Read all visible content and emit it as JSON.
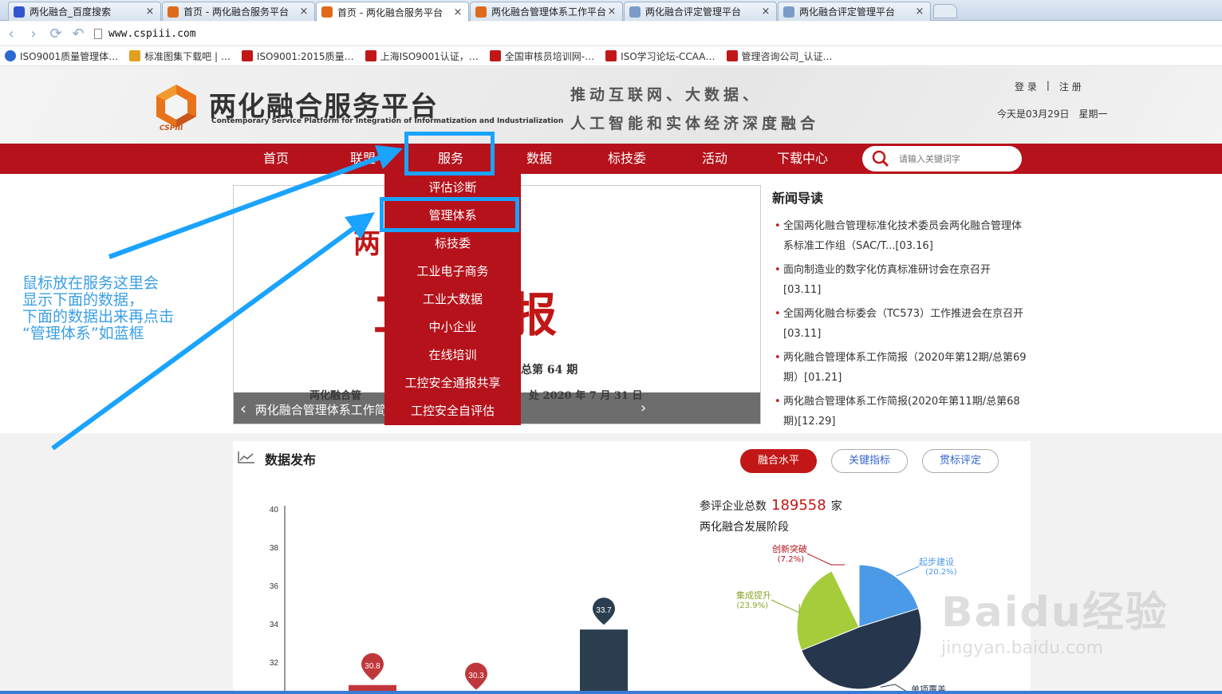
{
  "browser": {
    "tabs": [
      {
        "label": "两化融合_百度搜索",
        "color": "#3355cc"
      },
      {
        "label": "首页 - 两化融合服务平台",
        "color": "#e06a1b"
      },
      {
        "label": "首页 - 两化融合服务平台",
        "color": "#e06a1b"
      },
      {
        "label": "两化融合管理体系工作平台",
        "color": "#e06a1b"
      },
      {
        "label": "两化融合评定管理平台",
        "color": "#7a9cc6"
      },
      {
        "label": "两化融合评定管理平台",
        "color": "#7a9cc6"
      }
    ],
    "active_tab": 2,
    "url": "www.cspiii.com",
    "bookmarks": [
      {
        "label": "ISO9001质量管理体…",
        "color": "#2a6bd1"
      },
      {
        "label": "标准图集下载吧 | …",
        "color": "#e0a020"
      },
      {
        "label": "ISO9001:2015质量…",
        "color": "#c21717"
      },
      {
        "label": "上海ISO9001认证，…",
        "color": "#c21717"
      },
      {
        "label": "全国审核员培训网-…",
        "color": "#c21717"
      },
      {
        "label": "ISO学习论坛-CCAA…",
        "color": "#c21717"
      },
      {
        "label": "管理咨询公司_认证…",
        "color": "#c21717"
      }
    ]
  },
  "header": {
    "title": "两化融合服务平台",
    "subtitle": "Contemporary Service Platform for Integration of Informatization and Industrialization",
    "logo_text": "CSPIII",
    "slogan_line1": "推动互联网、大数据、",
    "slogan_line2": "人工智能和实体经济深度融合",
    "login": "登 录",
    "divider": "|",
    "register": "注 册",
    "date": "今天是03月29日",
    "weekday": "星期一"
  },
  "nav": {
    "items": [
      "首页",
      "联盟",
      "服务",
      "数据",
      "标技委",
      "活动",
      "下载中心"
    ],
    "search_placeholder": "请输入关键词字"
  },
  "dropdown": {
    "items": [
      "评估诊断",
      "管理体系",
      "标技委",
      "工业电子商务",
      "工业大数据",
      "中小企业",
      "在线培训",
      "工控安全通报共享",
      "工控安全自评估"
    ]
  },
  "banner": {
    "title_partial": "两          理体系",
    "big": "工  简报",
    "issue": "总第 64 期",
    "org": "两化融合管",
    "date": "处   2020 年 7 月 31 日",
    "caption": "两化融合管理体系工作简",
    "prev": "‹",
    "next": "›"
  },
  "news": {
    "heading": "新闻导读",
    "items": [
      "全国两化融合管理标准化技术委员会两化融合管理体系标准工作组（SAC/T...[03.16]",
      "面向制造业的数字化仿真标准研讨会在京召开[03.11]",
      "全国两化融合标委会（TC573）工作推进会在京召开[03.11]",
      "两化融合管理体系工作简报（2020年第12期/总第69期）[01.21]",
      "两化融合管理体系工作简报(2020年第11期/总第68期)[12.29]"
    ]
  },
  "data_section": {
    "title": "数据发布",
    "tabs": [
      "融合水平",
      "关键指标",
      "贯标评定"
    ],
    "active_tab": 0,
    "total_label": "参评企业总数",
    "total_value": "189558",
    "total_unit": "家",
    "stage_label": "两化融合发展阶段"
  },
  "chart_data": [
    {
      "type": "bar",
      "yticks": [
        32,
        34,
        36,
        38,
        40
      ],
      "ylim": [
        30,
        40
      ],
      "series": [
        {
          "values": [
            30.8,
            30.3,
            33.7
          ],
          "colors": [
            "#c0373b",
            "#c0373b",
            "#2b3e50"
          ]
        }
      ],
      "value_labels": [
        "30.8",
        "30.3",
        "33.7"
      ]
    },
    {
      "type": "pie",
      "slices": [
        {
          "label": "起步建设",
          "pct_label": "(20.2%)",
          "value": 20.2,
          "color": "#4a9ae8"
        },
        {
          "label": "单项覆盖",
          "pct_label": "",
          "value": 48.7,
          "color": "#26374d"
        },
        {
          "label": "集成提升",
          "pct_label": "(23.9%)",
          "value": 23.9,
          "color": "#a5cc3a"
        },
        {
          "label": "创新突破",
          "pct_label": "(7.2%)",
          "value": 7.2,
          "color": "#ffffff"
        }
      ]
    }
  ],
  "annotation": {
    "lines": [
      "鼠标放在服务这里会",
      "显示下面的数据，",
      "下面的数据出来再点击",
      "“管理体系”如蓝框"
    ]
  },
  "watermark": {
    "main": "Baidu经验",
    "sub": "jingyan.baidu.com"
  }
}
